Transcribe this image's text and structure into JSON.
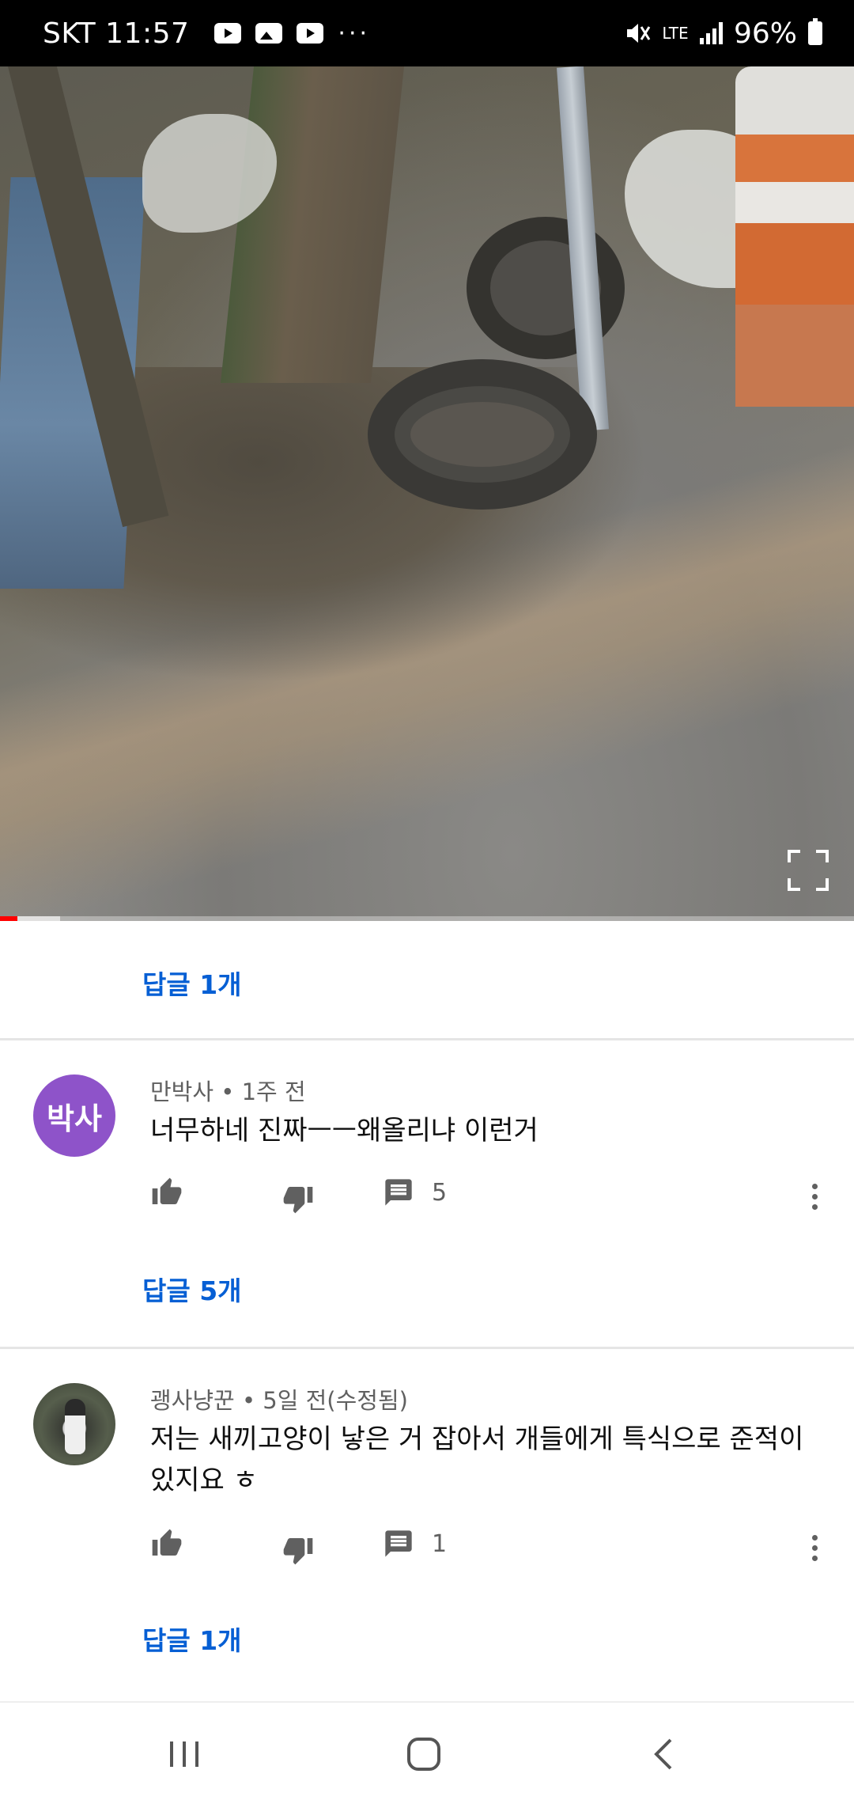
{
  "status_bar": {
    "carrier": "SKT",
    "time": "11:57",
    "more": "···",
    "network": "LTE",
    "battery": "96%"
  },
  "video": {
    "progress_fraction": 0.02,
    "buffer_fraction": 0.07
  },
  "thread_top": {
    "replies_label": "답글 1개"
  },
  "comments": [
    {
      "avatar_text": "박사",
      "author": "만박사",
      "separator": "•",
      "time": "1주 전",
      "text": "너무하네 진짜ㅡㅡ왜올리냐 이런거",
      "reply_count": "5",
      "replies_label": "답글 5개"
    },
    {
      "author": "괭사냥꾼",
      "separator": "•",
      "time": "5일 전(수정됨)",
      "text": "저는 새끼고양이 낳은 거 잡아서 개들에게 특식으로 준적이 있지요 ㅎ",
      "reply_count": "1",
      "replies_label": "답글 1개"
    }
  ],
  "colors": {
    "link": "#065fd4",
    "avatar_purple": "#8e53c9",
    "progress_red": "#ff0000"
  }
}
